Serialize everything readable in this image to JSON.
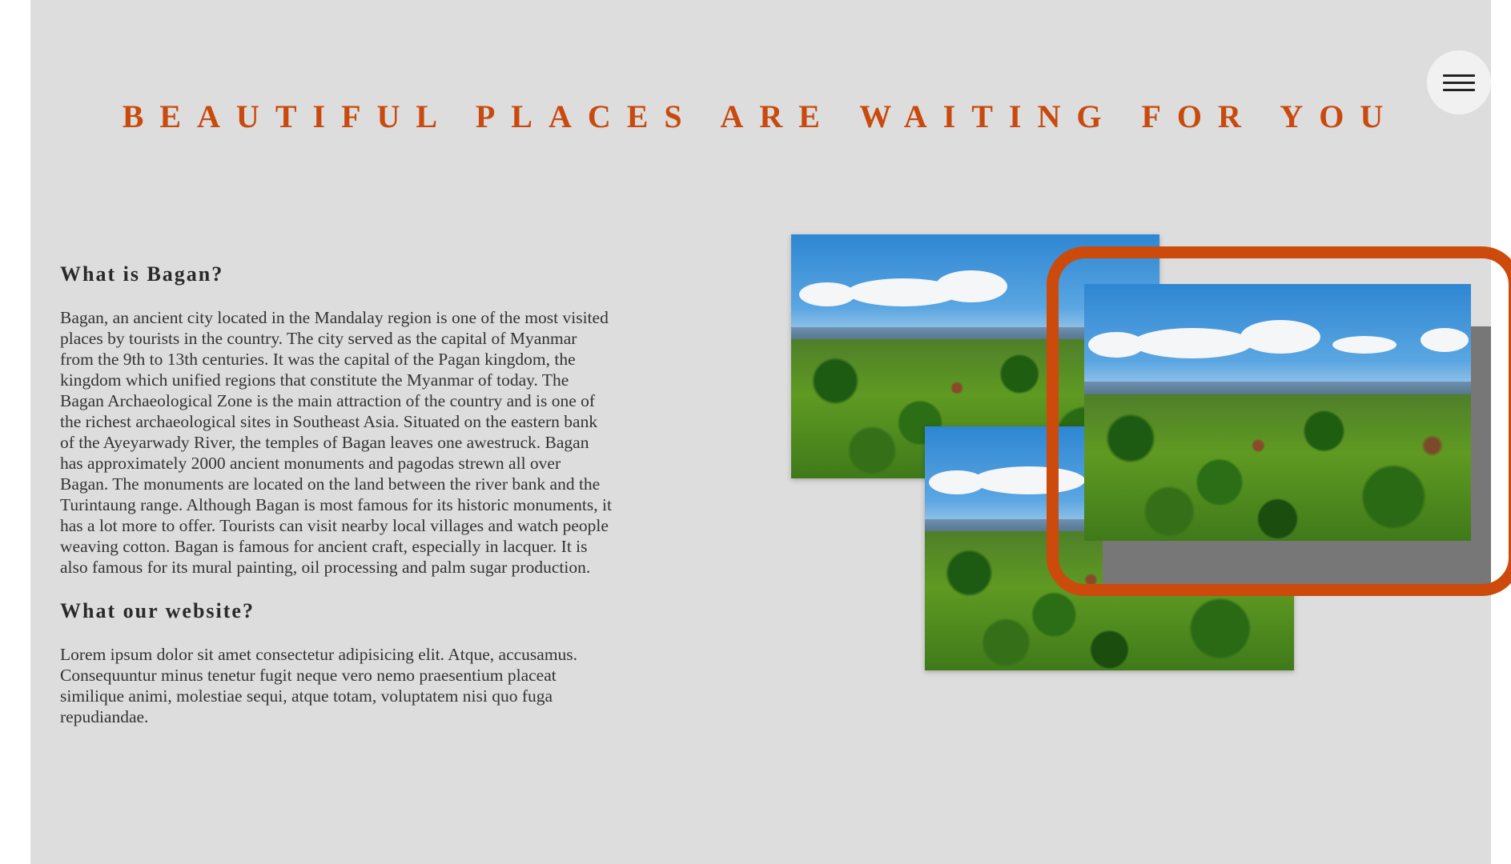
{
  "header": {
    "title": "BEAUTIFUL PLACES ARE WAITING FOR YOU",
    "menu_icon": "hamburger-menu-icon"
  },
  "colors": {
    "accent": "#c84a0e",
    "background": "#dddddd"
  },
  "content": {
    "section1": {
      "heading": "What is Bagan?",
      "body": "Bagan, an ancient city located in the Mandalay region is one of the most visited places by tourists in the country. The city served as the capital of Myanmar from the 9th to 13th centuries. It was the capital of the Pagan kingdom, the kingdom which unified regions that constitute the Myanmar of today. The Bagan Archaeological Zone is the main attraction of the country and is one of the richest archaeological sites in Southeast Asia. Situated on the eastern bank of the Ayeyarwady River, the temples of Bagan leaves one awestruck. Bagan has approximately 2000 ancient monuments and pagodas strewn all over Bagan. The monuments are located on the land between the river bank and the Turintaung range. Although Bagan is most famous for its historic monuments, it has a lot more to offer. Tourists can visit nearby local villages and watch people weaving cotton. Bagan is famous for ancient craft, especially in lacquer. It is also famous for its mural painting, oil processing and palm sugar production."
    },
    "section2": {
      "heading": "What our website?",
      "body": "Lorem ipsum dolor sit amet consectetur adipisicing elit. Atque, accusamus. Consequuntur minus tenetur fugit neque vero nemo praesentium placeat similique animi, molestiae sequi, atque totam, voluptatem nisi quo fuga repudiandae."
    }
  },
  "gallery": {
    "images": [
      "bagan-landscape-photo",
      "bagan-landscape-photo",
      "bagan-landscape-photo"
    ]
  }
}
